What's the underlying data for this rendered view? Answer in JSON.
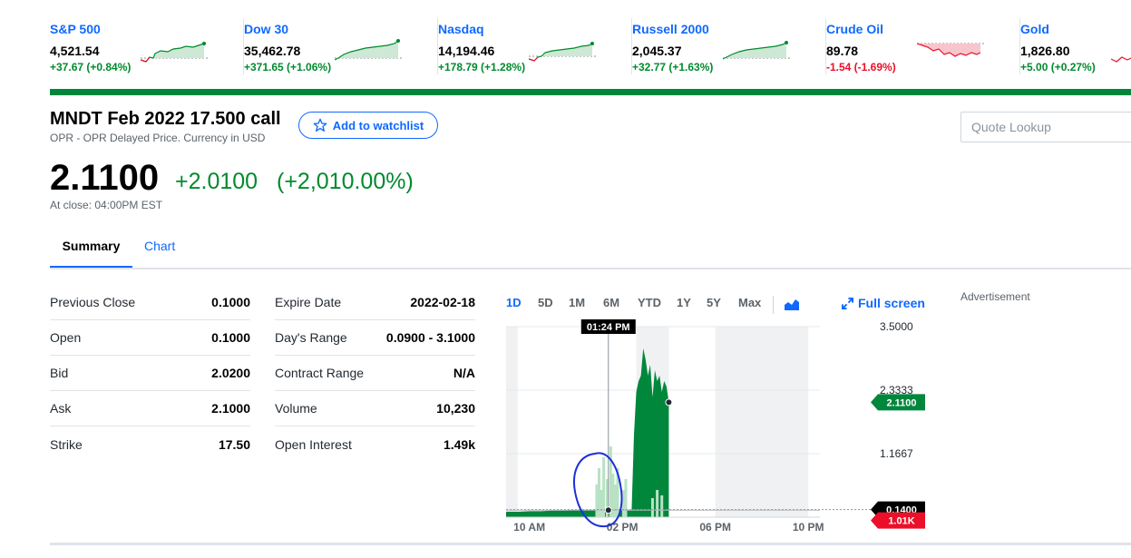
{
  "tickers": [
    {
      "name": "S&P 500",
      "price": "4,521.54",
      "change": "+37.67 (+0.84%)",
      "direction": "up"
    },
    {
      "name": "Dow 30",
      "price": "35,462.78",
      "change": "+371.65 (+1.06%)",
      "direction": "up"
    },
    {
      "name": "Nasdaq",
      "price": "14,194.46",
      "change": "+178.79 (+1.28%)",
      "direction": "up"
    },
    {
      "name": "Russell 2000",
      "price": "2,045.37",
      "change": "+32.77 (+1.63%)",
      "direction": "up"
    },
    {
      "name": "Crude Oil",
      "price": "89.78",
      "change": "-1.54 (-1.69%)",
      "direction": "down"
    },
    {
      "name": "Gold",
      "price": "1,826.80",
      "change": "+5.00 (+0.27%)",
      "direction": "up"
    }
  ],
  "quote": {
    "title": "MNDT Feb 2022 17.500 call",
    "subtitle": "OPR - OPR Delayed Price. Currency in USD",
    "watchlist_label": "Add to watchlist",
    "price": "2.1100",
    "change": "+2.0100",
    "change_pct": "(+2,010.00%)",
    "at_close": "At close: 04:00PM EST"
  },
  "search": {
    "placeholder": "Quote Lookup"
  },
  "tabs": [
    "Summary",
    "Chart"
  ],
  "stats_left": [
    {
      "label": "Previous Close",
      "value": "0.1000"
    },
    {
      "label": "Open",
      "value": "0.1000"
    },
    {
      "label": "Bid",
      "value": "2.0200"
    },
    {
      "label": "Ask",
      "value": "2.1000"
    },
    {
      "label": "Strike",
      "value": "17.50"
    }
  ],
  "stats_right": [
    {
      "label": "Expire Date",
      "value": "2022-02-18"
    },
    {
      "label": "Day's Range",
      "value": "0.0900 - 3.1000"
    },
    {
      "label": "Contract Range",
      "value": "N/A"
    },
    {
      "label": "Volume",
      "value": "10,230"
    },
    {
      "label": "Open Interest",
      "value": "1.49k"
    }
  ],
  "chart_controls": {
    "ranges": [
      "1D",
      "5D",
      "1M",
      "6M",
      "YTD",
      "1Y",
      "5Y",
      "Max"
    ],
    "selected": "1D",
    "fullscreen_label": "Full screen"
  },
  "advertisement_label": "Advertisement",
  "colors": {
    "up": "#008a2e",
    "down": "#eb0f29",
    "accent": "#0f69ff",
    "chart_fill": "#00873c"
  },
  "chart_data": {
    "type": "area",
    "y_ticks": [
      "3.5000",
      "2.3333",
      "1.1667"
    ],
    "ylim": [
      0,
      3.5
    ],
    "x_ticks": [
      "10 AM",
      "02 PM",
      "06 PM",
      "10 PM"
    ],
    "xlim_hours": [
      9,
      22.5
    ],
    "shaded_sessions": [
      [
        9,
        9.5
      ],
      [
        14.6,
        16
      ],
      [
        18,
        22
      ]
    ],
    "crosshair_label": "01:24 PM",
    "crosshair_hour": 13.4,
    "price_label": "2.1100",
    "price_value": 2.11,
    "prev_close_label": "0.1400",
    "prev_close_value": 0.14,
    "volume_label": "1.01K",
    "series": [
      {
        "name": "",
        "points": [
          [
            9.0,
            0.1
          ],
          [
            9.5,
            0.1
          ],
          [
            10.0,
            0.11
          ],
          [
            10.5,
            0.11
          ],
          [
            11.0,
            0.12
          ],
          [
            11.5,
            0.12
          ],
          [
            12.0,
            0.13
          ],
          [
            12.5,
            0.13
          ],
          [
            13.0,
            0.13
          ],
          [
            13.4,
            0.13
          ],
          [
            13.8,
            0.13
          ],
          [
            14.2,
            0.13
          ],
          [
            14.4,
            0.12
          ],
          [
            14.5,
            1.5
          ],
          [
            14.6,
            2.3
          ],
          [
            14.7,
            2.5
          ],
          [
            14.8,
            2.6
          ],
          [
            14.9,
            3.1
          ],
          [
            15.0,
            2.9
          ],
          [
            15.1,
            2.6
          ],
          [
            15.2,
            2.8
          ],
          [
            15.3,
            2.2
          ],
          [
            15.4,
            2.7
          ],
          [
            15.5,
            2.5
          ],
          [
            15.6,
            2.6
          ],
          [
            15.7,
            2.3
          ],
          [
            15.8,
            2.5
          ],
          [
            15.9,
            2.4
          ],
          [
            16.0,
            2.11
          ]
        ]
      }
    ]
  }
}
